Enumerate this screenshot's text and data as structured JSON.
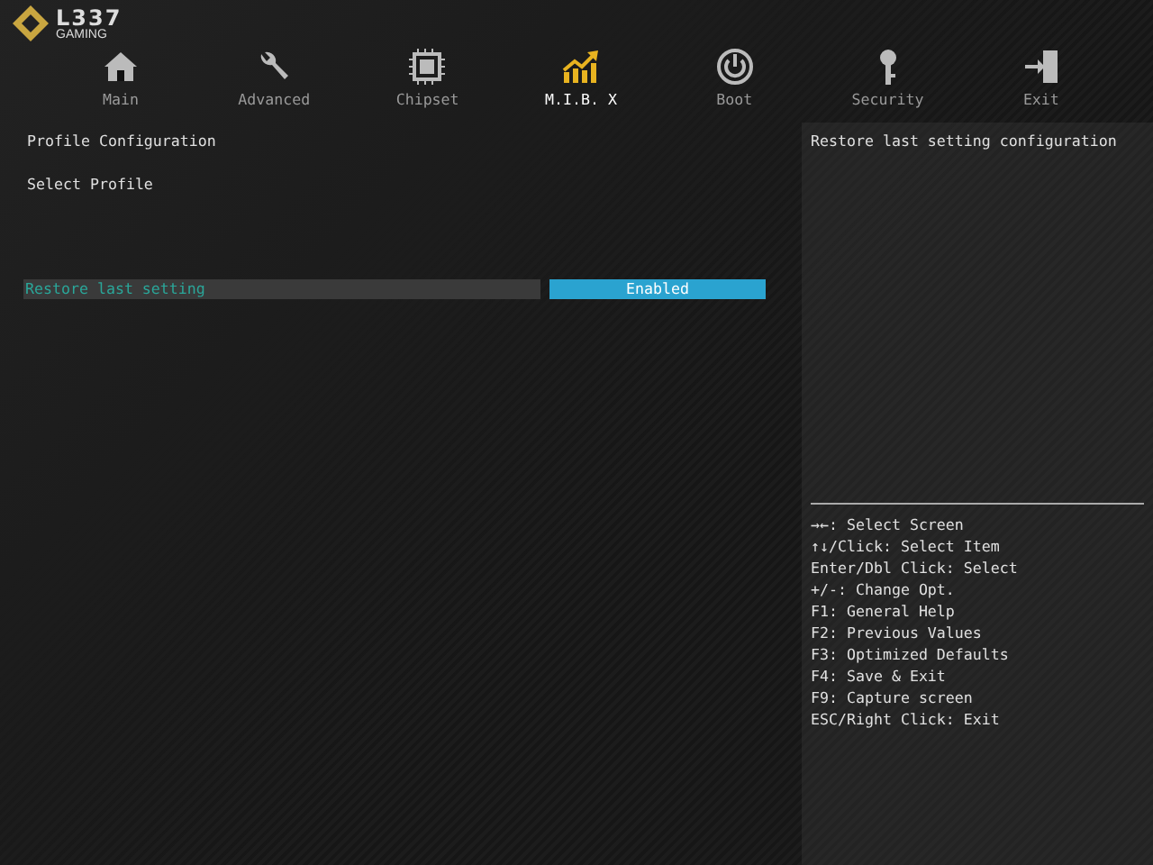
{
  "logo": {
    "name": "L337",
    "sub": "GAMING"
  },
  "tabs": [
    {
      "label": "Main",
      "kind": "home",
      "selected": false
    },
    {
      "label": "Advanced",
      "kind": "wrench",
      "selected": false
    },
    {
      "label": "Chipset",
      "kind": "chip",
      "selected": false
    },
    {
      "label": "M.I.B. X",
      "kind": "chart",
      "selected": true
    },
    {
      "label": "Boot",
      "kind": "power",
      "selected": false
    },
    {
      "label": "Security",
      "kind": "key",
      "selected": false
    },
    {
      "label": "Exit",
      "kind": "exit",
      "selected": false
    }
  ],
  "items": [
    {
      "kind": "heading",
      "label": "Profile Configuration"
    },
    {
      "kind": "heading",
      "label": "Select Profile"
    },
    {
      "kind": "setting",
      "label": "Restore last setting",
      "value": "Enabled",
      "selected": true
    }
  ],
  "help_text": "Restore last setting configuration",
  "key_help": [
    "→←: Select Screen",
    "↑↓/Click: Select Item",
    "Enter/Dbl Click: Select",
    "+/-: Change Opt.",
    "F1: General Help",
    "F2: Previous Values",
    "F3: Optimized Defaults",
    "F4: Save & Exit",
    "F9: Capture screen",
    "ESC/Right Click: Exit"
  ]
}
